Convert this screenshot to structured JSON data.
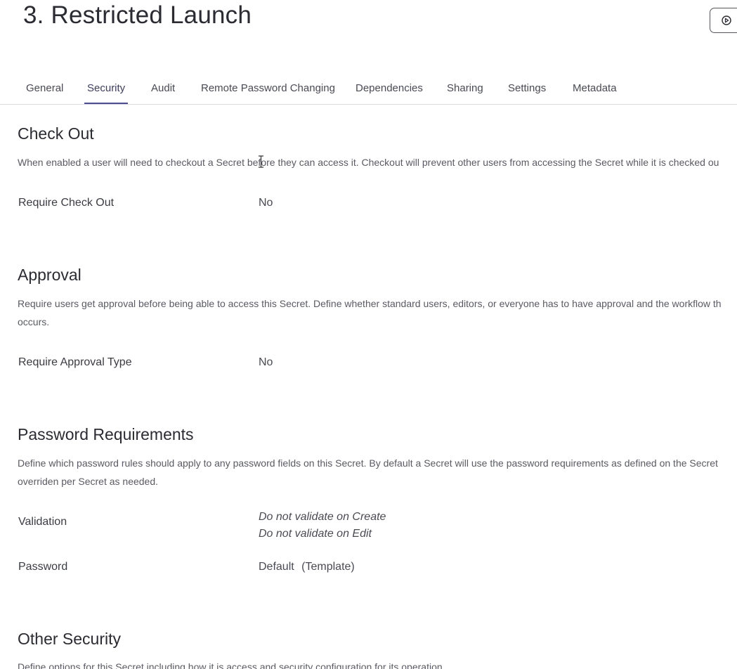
{
  "header": {
    "title": "3. Restricted Launch"
  },
  "tabs": [
    {
      "label": "General"
    },
    {
      "label": "Security"
    },
    {
      "label": "Audit"
    },
    {
      "label": "Remote Password Changing"
    },
    {
      "label": "Dependencies"
    },
    {
      "label": "Sharing"
    },
    {
      "label": "Settings"
    },
    {
      "label": "Metadata"
    }
  ],
  "active_tab": "Security",
  "sections": {
    "checkout": {
      "title": "Check Out",
      "description": "When enabled a user will need to checkout a Secret before they can access it. Checkout will prevent other users from accessing the Secret while it is checked ou",
      "require_checkout_label": "Require Check Out",
      "require_checkout_value": "No"
    },
    "approval": {
      "title": "Approval",
      "description_line1": "Require users get approval before being able to access this Secret. Define whether standard users, editors, or everyone has to have approval and the workflow th",
      "description_line2": "occurs.",
      "require_approval_label": "Require Approval Type",
      "require_approval_value": "No"
    },
    "password_requirements": {
      "title": "Password Requirements",
      "description_line1": "Define which password rules should apply to any password fields on this Secret. By default a Secret will use the password requirements as defined on the Secret",
      "description_line2": "overriden per Secret as needed.",
      "validation_label": "Validation",
      "validation_value_create": "Do not validate on Create",
      "validation_value_edit": "Do not validate on Edit",
      "password_label": "Password",
      "password_value": "Default",
      "password_value_suffix": "(Template)"
    },
    "other_security": {
      "title": "Other Security",
      "description": "Define options for this Secret including how it is access and security configuration for its operation."
    }
  },
  "icons": {
    "run_button_icon": "play-circle-icon",
    "text_cursor_icon": "text-cursor-icon"
  },
  "colors": {
    "accent": "#4a4aa0",
    "title_text": "#2b2b33",
    "body_text": "#4a4a55",
    "divider": "#d9d9de"
  }
}
